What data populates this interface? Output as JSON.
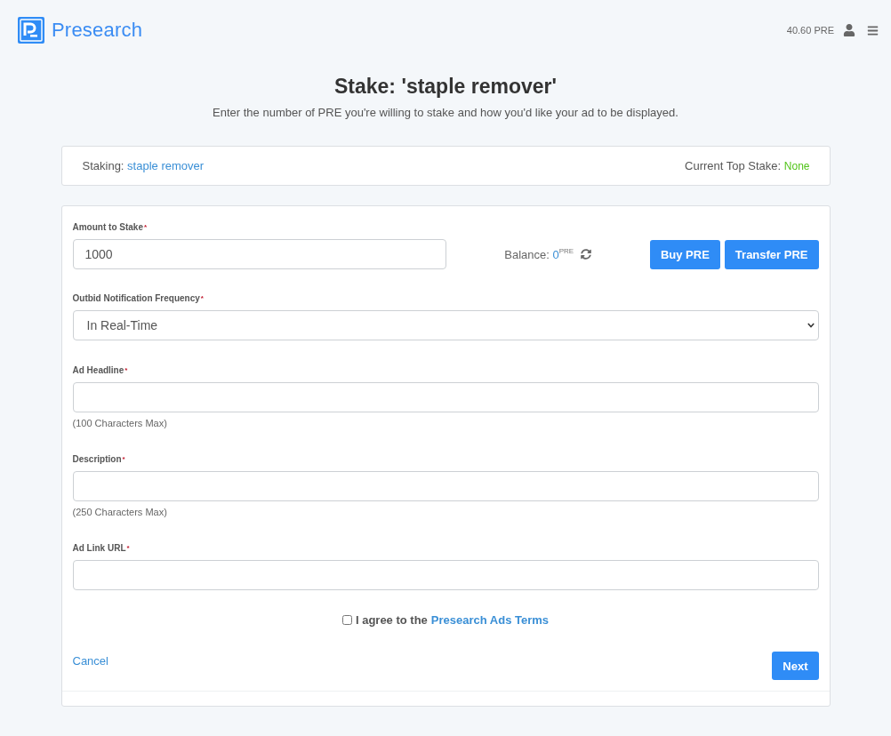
{
  "header": {
    "logo_text": "Presearch",
    "balance": "40.60 PRE"
  },
  "intro": {
    "title": "Stake: 'staple remover'",
    "subtitle": "Enter the number of PRE you're willing to stake and how you'd like your ad to be displayed."
  },
  "staking_bar": {
    "label": "Staking:",
    "keyword": "staple remover",
    "top_stake_label": "Current Top Stake:",
    "top_stake_value": "None"
  },
  "amount": {
    "label": "Amount to Stake",
    "mark": "*",
    "value": "1000"
  },
  "balance": {
    "label": "Balance:",
    "value": "0",
    "unit": "PRE"
  },
  "buttons": [
    {
      "label": "Buy PRE"
    },
    {
      "label": "Transfer PRE"
    }
  ],
  "fields": [
    {
      "kind": "select",
      "label": "Outbid Notification Frequency",
      "mark": "*",
      "value": "In Real-Time"
    },
    {
      "kind": "input",
      "label": "Ad Headline",
      "mark": "*",
      "hint": "(100 Characters Max)"
    },
    {
      "kind": "input",
      "label": "Description",
      "mark": "*",
      "hint": "(250 Characters Max)"
    },
    {
      "kind": "input",
      "label": "Ad Link URL",
      "mark": "*"
    }
  ],
  "agreement": {
    "checked": false,
    "text": "I agree to the",
    "link": "Presearch Ads Terms"
  },
  "actions": {
    "cancel": "Cancel",
    "next": "Next"
  }
}
